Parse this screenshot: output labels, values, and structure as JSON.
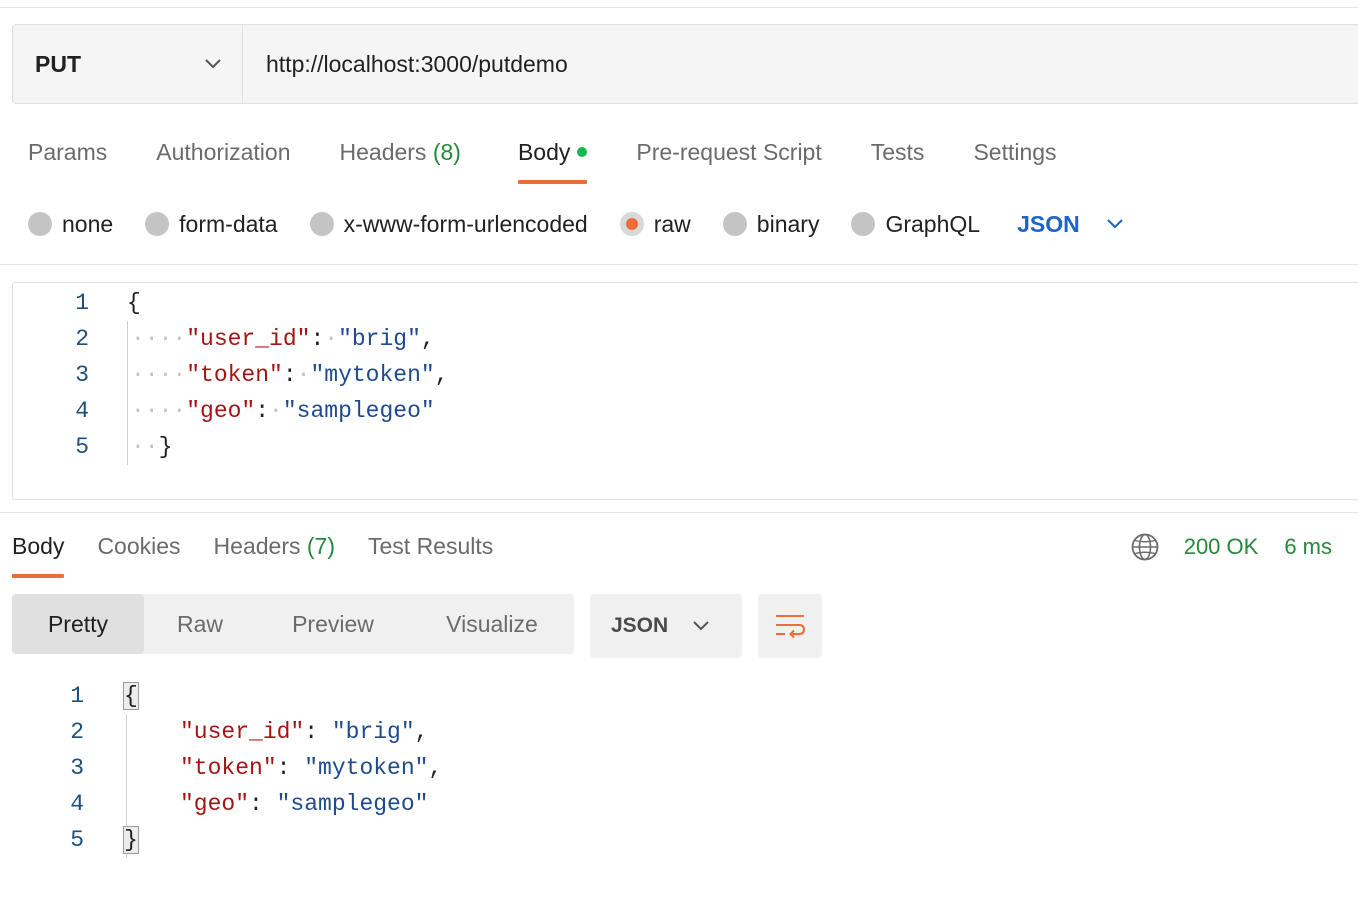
{
  "request": {
    "method": "PUT",
    "url": "http://localhost:3000/putdemo",
    "tabs": [
      {
        "label": "Params"
      },
      {
        "label": "Authorization"
      },
      {
        "label": "Headers",
        "count": "(8)"
      },
      {
        "label": "Body"
      },
      {
        "label": "Pre-request Script"
      },
      {
        "label": "Tests"
      },
      {
        "label": "Settings"
      }
    ],
    "body_types": [
      "none",
      "form-data",
      "x-www-form-urlencoded",
      "raw",
      "binary",
      "GraphQL"
    ],
    "selected_body_type": "raw",
    "body_format": "JSON",
    "editor": {
      "line_numbers": [
        "1",
        "2",
        "3",
        "4",
        "5"
      ],
      "open_brace": "{",
      "close_brace": "}",
      "fields": [
        {
          "key": "\"user_id\"",
          "value": "\"brig\"",
          "sep": ","
        },
        {
          "key": "\"token\"",
          "value": "\"mytoken\"",
          "sep": ","
        },
        {
          "key": "\"geo\"",
          "value": "\"samplegeo\"",
          "sep": ""
        }
      ]
    }
  },
  "response": {
    "tabs": [
      {
        "label": "Body"
      },
      {
        "label": "Cookies"
      },
      {
        "label": "Headers",
        "count": "(7)"
      },
      {
        "label": "Test Results"
      }
    ],
    "status": "200 OK",
    "time": "6 ms",
    "views": [
      "Pretty",
      "Raw",
      "Preview",
      "Visualize"
    ],
    "active_view": "Pretty",
    "format": "JSON",
    "editor": {
      "line_numbers": [
        "1",
        "2",
        "3",
        "4",
        "5"
      ],
      "open_brace": "{",
      "close_brace": "}",
      "fields": [
        {
          "key": "\"user_id\"",
          "value": "\"brig\"",
          "sep": ","
        },
        {
          "key": "\"token\"",
          "value": "\"mytoken\"",
          "sep": ","
        },
        {
          "key": "\"geo\"",
          "value": "\"samplegeo\"",
          "sep": ""
        }
      ]
    }
  },
  "colors": {
    "accent": "#ec6d39",
    "status_green": "#26883a",
    "json_blue": "#1e64c8",
    "json_key": "#a31515",
    "json_string": "#1e4a8e"
  },
  "icons": [
    "chevron-down-icon",
    "globe-icon",
    "wrap-lines-icon"
  ]
}
